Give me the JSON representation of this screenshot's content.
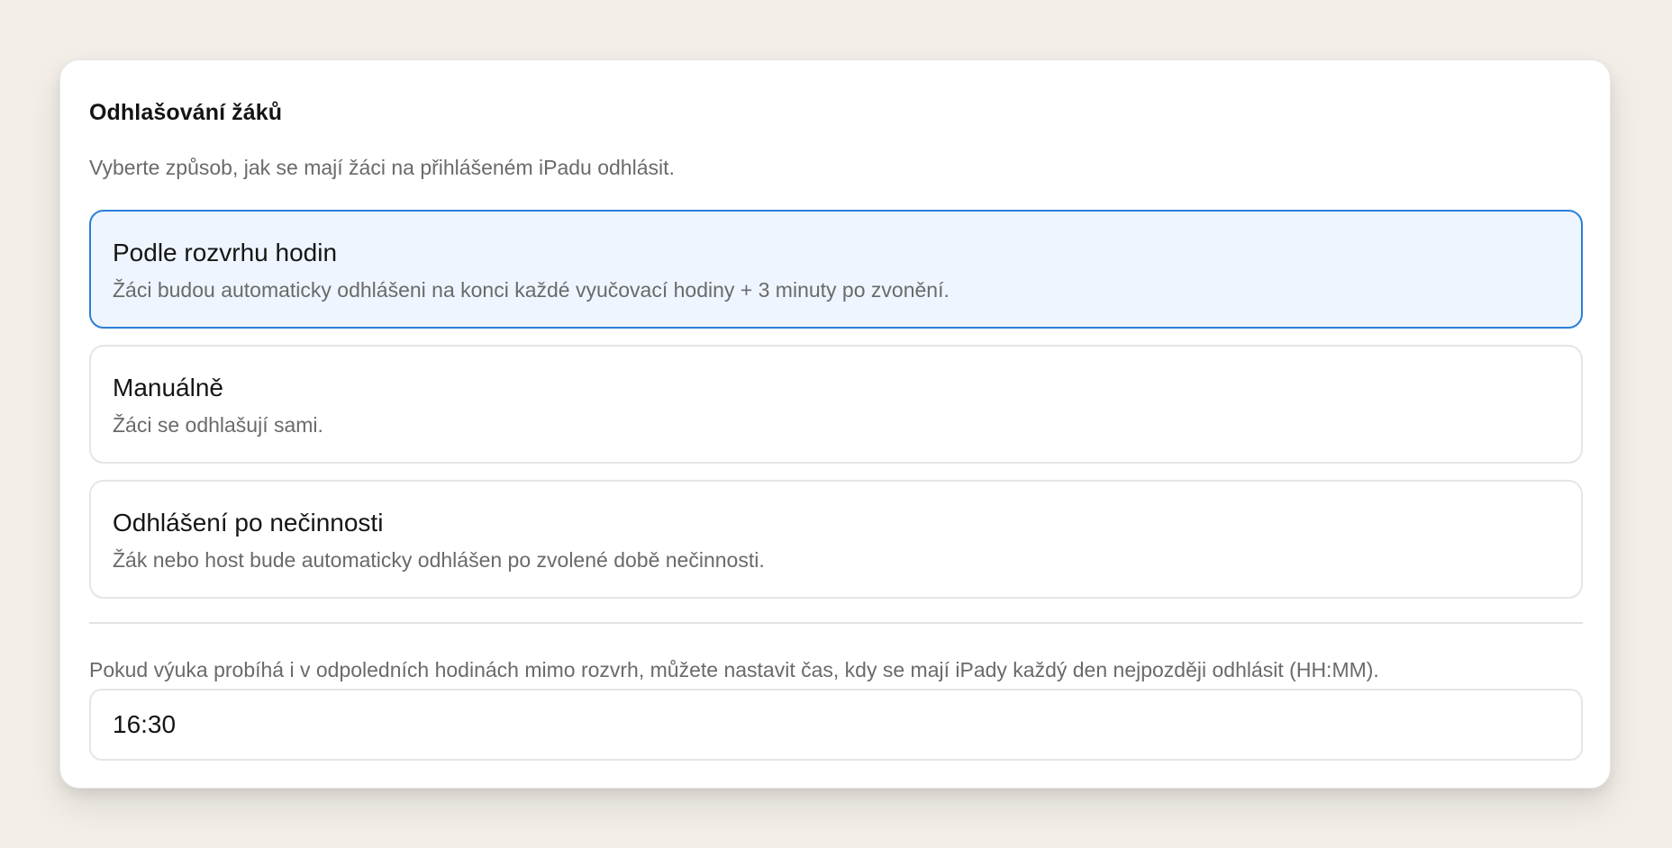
{
  "section": {
    "title": "Odhlašování žáků",
    "subtitle": "Vyberte způsob, jak se mají žáci na přihlášeném iPadu odhlásit."
  },
  "options": [
    {
      "title": "Podle rozvrhu hodin",
      "description": "Žáci budou automaticky odhlášeni na konci každé vyučovací hodiny + 3 minuty po zvonění.",
      "selected": true
    },
    {
      "title": "Manuálně",
      "description": "Žáci se odhlašují sami.",
      "selected": false
    },
    {
      "title": "Odhlášení po nečinnosti",
      "description": "Žák nebo host bude automaticky odhlášen po zvolené době nečinnosti.",
      "selected": false
    }
  ],
  "latest_logout": {
    "note": "Pokud výuka probíhá i v odpoledních hodinách mimo rozvrh, můžete nastavit čas, kdy se mají iPady každý den nejpozději odhlásit (HH:MM).",
    "value": "16:30"
  },
  "colors": {
    "accent": "#2a7fd8",
    "selected_background": "#eef5ff",
    "page_background": "#f3efe8"
  }
}
